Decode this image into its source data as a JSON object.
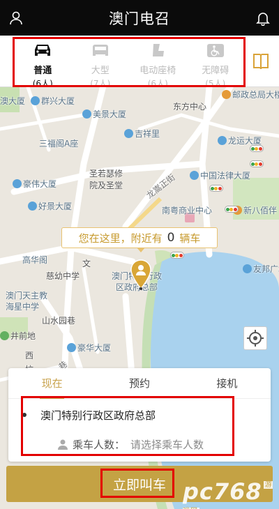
{
  "header": {
    "title": "澳门电召",
    "left_icon": "user-icon",
    "right_icon": "bell-icon"
  },
  "car_types": [
    {
      "name": "普通",
      "count": "(6人)",
      "icon": "sedan-icon",
      "active": true
    },
    {
      "name": "大型",
      "count": "(7人)",
      "icon": "van-icon",
      "active": false
    },
    {
      "name": "电动座椅",
      "count": "(6人)",
      "icon": "power-seat-icon",
      "active": false
    },
    {
      "name": "无障碍",
      "count": "(5人)",
      "icon": "wheelchair-icon",
      "active": false
    }
  ],
  "map": {
    "labels": {
      "l1": "澳大厦",
      "l2": "群兴大厦",
      "l3": "东方中心",
      "l4": "邮政总局大楼",
      "l5": "美景大厦",
      "l6": "吉祥里",
      "l7": "三福阁A座",
      "l8": "龙运大厦",
      "l9": "圣若瑟修",
      "l10": "院及圣堂",
      "l11": "龙嵩正街",
      "l12": "中国法律大厦",
      "l13": "豪伟大厦",
      "l14": "好景大厦",
      "l15": "南粤商业中心",
      "l16": "新八佰伴",
      "l17": "高华阁",
      "l18": "文",
      "l19": "慈幼中学",
      "l20": "澳门特别行政",
      "l21": "区政府总部",
      "l22": "友邦广场",
      "l23": "澳门天主教",
      "l24": "海星中学",
      "l25": "山水园巷",
      "l26": "井前地",
      "l27": "豪华大厦",
      "l28": "西",
      "l29": "坑",
      "l30": "巷",
      "l31": "高地巷"
    },
    "nearby": {
      "prefix": "您在这里，附近有",
      "count": "0",
      "suffix": "辆车"
    }
  },
  "panel": {
    "tabs": [
      "现在",
      "预约",
      "接机"
    ],
    "active_tab": "现在",
    "location": "澳门特别行政区政府总部",
    "passenger_label": "乘车人数：",
    "passenger_placeholder": "请选择乘车人数"
  },
  "call_button": "立即叫车",
  "watermark": {
    "text": "pc768",
    "badge": "游戏网"
  },
  "colors": {
    "accent": "#c4a244",
    "highlight_box": "#e30000"
  }
}
